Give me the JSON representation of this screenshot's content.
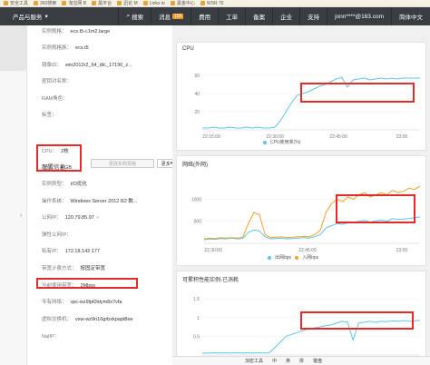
{
  "bookmarks": [
    "安全工具",
    "360搜索",
    "淘宝网 B",
    "黑平台",
    "迅论 M",
    "Links to",
    "黑金中心",
    "WSR 76"
  ],
  "topnav": {
    "product": "产品与服务",
    "search": "搜索",
    "messages": "消息",
    "messages_count": "118",
    "billing": "费用",
    "tickets": "工单",
    "icp": "备案",
    "enterprise": "企业",
    "support": "支持",
    "user": "jonn****@163.com",
    "language": "简体中文"
  },
  "info": {
    "row_spec": {
      "label": "实例规格：",
      "value": "ecs.t5-c1m2.large"
    },
    "row_family": {
      "label": "实例规格族：",
      "value": "ecs.t5"
    },
    "row_image": {
      "label": "镜像ID：",
      "value": "win2012r2_64_dtc_17196_z..."
    },
    "row_key": {
      "label": "密钥对名称：",
      "value": ""
    },
    "row_ram": {
      "label": "RAM角色：",
      "value": ""
    },
    "row_tags": {
      "label": "标签：",
      "value": ""
    },
    "section": "配置信息",
    "btn_change": "更改实例规格",
    "btn_more": "更多",
    "row_cpu": {
      "label": "CPU：",
      "value": "2核"
    },
    "row_mem": {
      "label": "内存：",
      "value": "4 GB"
    },
    "row_io": {
      "label": "实例类型：",
      "value": "I/O优化"
    },
    "row_os": {
      "label": "操作系统：",
      "value": "Windows Server 2012 R2 数..."
    },
    "row_public_ip": {
      "label": "公网IP：",
      "value": "120.79.85.97"
    },
    "row_eip": {
      "label": "弹性公网IP：",
      "value": ""
    },
    "row_private_ip": {
      "label": "私有IP：",
      "value": "172.18.142.177"
    },
    "row_billing_mode": {
      "label": "带宽计费方式：",
      "value": "按固定带宽"
    },
    "row_bandwidth": {
      "label": "当前使用带宽：",
      "value": "2Mbps"
    },
    "row_vpc": {
      "label": "专有网络：",
      "value": "vpc-wz9lpt0ldym8x7vfa"
    },
    "row_vswitch": {
      "label": "虚拟交换机：",
      "value": "vsw-wz9n16grbxkpapt8ee"
    },
    "row_nat": {
      "label": "NatIP：",
      "value": ""
    }
  },
  "charts": {
    "cpu": {
      "title": "CPU",
      "legend": "CPU使用率(%)"
    },
    "net": {
      "title": "网络(外网)",
      "legend_out": "出网bps",
      "legend_in": "入网bps"
    },
    "credit": {
      "title": "可累积性能实例-已消耗"
    }
  },
  "chart_data": [
    {
      "type": "line",
      "title": "CPU",
      "x_ticks": [
        "22:15:00",
        "22:30:00",
        "22:45:00",
        "23:00"
      ],
      "y_ticks": [
        "20",
        "40",
        "60"
      ],
      "ylim": [
        0,
        70
      ],
      "series": [
        {
          "name": "CPU使用率(%)",
          "color": "#5ec4e8",
          "values": [
            2,
            2,
            3,
            2,
            2,
            3,
            2,
            2,
            3,
            2,
            3,
            2,
            2,
            3,
            10,
            20,
            30,
            38,
            40,
            42,
            45,
            48,
            50,
            53,
            56,
            58,
            47,
            55,
            56,
            57,
            55,
            56,
            57,
            56,
            57,
            56,
            57,
            57,
            57,
            57
          ]
        }
      ]
    },
    {
      "type": "line",
      "title": "网络(外网)",
      "x_ticks": [
        "22:30:00",
        "22:45:00",
        "23:00"
      ],
      "y_ticks": [
        "500",
        "1000"
      ],
      "ylim": [
        0,
        1400
      ],
      "series": [
        {
          "name": "出网bps",
          "color": "#5ec4e8",
          "values": [
            80,
            100,
            90,
            110,
            100,
            120,
            100,
            110,
            250,
            300,
            280,
            150,
            100,
            110,
            120,
            100,
            110,
            120,
            130,
            120,
            150,
            200,
            350,
            400,
            450,
            430,
            470,
            480,
            500,
            520,
            480,
            510,
            530,
            500,
            560,
            540,
            550,
            560,
            580,
            600
          ]
        },
        {
          "name": "入网bps",
          "color": "#f0a030",
          "values": [
            100,
            120,
            110,
            130,
            120,
            130,
            120,
            140,
            450,
            700,
            650,
            200,
            130,
            140,
            150,
            130,
            140,
            150,
            160,
            150,
            200,
            300,
            700,
            900,
            1000,
            950,
            1050,
            1000,
            1100,
            1150,
            1050,
            1100,
            1150,
            1100,
            1200,
            1150,
            1180,
            1250,
            1220,
            1300
          ]
        }
      ]
    },
    {
      "type": "line",
      "title": "可累积性能实例-已消耗",
      "x_ticks": [
        "22:15:00",
        "22:30:00",
        "22:45:00",
        "23:00"
      ],
      "y_ticks": [
        "0.5",
        "1",
        "1.5"
      ],
      "ylim": [
        0,
        1.6
      ],
      "series": [
        {
          "name": "",
          "color": "#5ec4e8",
          "values": [
            0.05,
            0.05,
            0.06,
            0.05,
            0.06,
            0.05,
            0.06,
            0.05,
            0.06,
            0.05,
            0.06,
            0.05,
            0.06,
            0.2,
            0.35,
            0.5,
            0.55,
            0.6,
            0.65,
            0.7,
            0.72,
            0.75,
            0.78,
            0.8,
            0.85,
            0.9,
            0.88,
            0.4,
            0.85,
            0.88,
            0.9,
            0.87,
            0.9,
            0.89,
            0.91,
            0.9,
            0.92,
            0.9,
            0.91,
            0.93
          ]
        }
      ]
    }
  ],
  "taskbar": {
    "encrypt": "加密工具",
    "zh": "中",
    "lang": "英",
    "ime": "拼",
    "kb": "键盘"
  }
}
